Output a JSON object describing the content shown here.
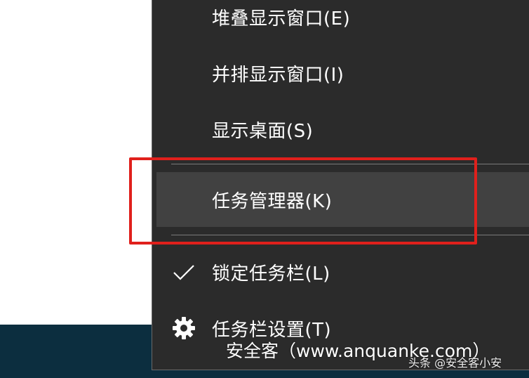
{
  "menu": {
    "cascade_windows": "堆叠显示窗口(E)",
    "side_by_side": "并排显示窗口(I)",
    "show_desktop": "显示桌面(S)",
    "task_manager": "任务管理器(K)",
    "lock_taskbar": "锁定任务栏(L)",
    "taskbar_settings": "任务栏设置(T)"
  },
  "icons": {
    "lock_taskbar": "checkmark-icon",
    "taskbar_settings": "gear-icon"
  },
  "annotation": {
    "highlight_color": "#e0201c"
  },
  "watermark": {
    "site": "安全客（www.anquanke.com）",
    "credit": "头条 @安全客小安"
  },
  "colors": {
    "menu_bg": "#2b2b2b",
    "hover_bg": "#414141",
    "taskbar_bg": "#0c2e3f"
  }
}
